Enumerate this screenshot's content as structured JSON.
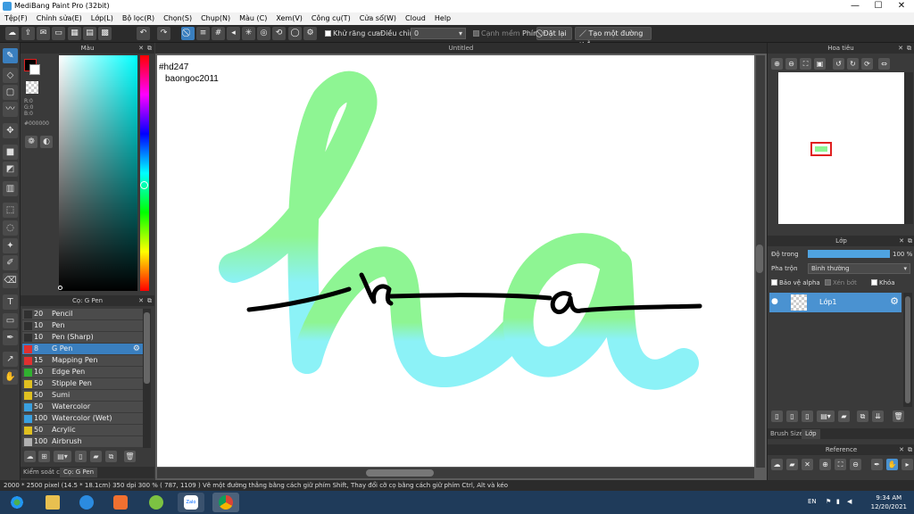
{
  "window": {
    "title": "MediBang Paint Pro (32bit)",
    "minimize": "—",
    "maximize": "☐",
    "close": "✕"
  },
  "menu": [
    "Tệp(F)",
    "Chỉnh sửa(E)",
    "Lớp(L)",
    "Bộ lọc(R)",
    "Chọn(S)",
    "Chụp(N)",
    "Màu (C)",
    "Xem(V)",
    "Công cụ(T)",
    "Cửa sổ(W)",
    "Cloud",
    "Help"
  ],
  "toolbar": {
    "antialias_label": "Khử răng cưa",
    "adjust_label": "Điều chỉnh",
    "adjust_value": "0",
    "smooth_edge_label": "Cạnh mềm",
    "key_label": "Phím",
    "reset_label": "Đặt lại",
    "create_line_label": "Tạo một đường thẳng"
  },
  "color_panel": {
    "title": "Màu",
    "r": "R:0",
    "g": "G:0",
    "b": "B:0",
    "hex": "#000000",
    "fg_color": "#000000",
    "hue_marker_fraction": 0.55
  },
  "brush_panel": {
    "title": "Cọ: G Pen",
    "brushes": [
      {
        "size": "20",
        "name": "Pencil",
        "color": "#303030",
        "selected": false
      },
      {
        "size": "10",
        "name": "Pen",
        "color": "#303030",
        "selected": false
      },
      {
        "size": "10",
        "name": "Pen (Sharp)",
        "color": "#303030",
        "selected": false
      },
      {
        "size": "8",
        "name": "G Pen",
        "color": "#e03030",
        "selected": true
      },
      {
        "size": "15",
        "name": "Mapping Pen",
        "color": "#e03030",
        "selected": false
      },
      {
        "size": "10",
        "name": "Edge Pen",
        "color": "#30b030",
        "selected": false
      },
      {
        "size": "50",
        "name": "Stipple Pen",
        "color": "#e0c020",
        "selected": false
      },
      {
        "size": "50",
        "name": "Sumi",
        "color": "#e0c020",
        "selected": false
      },
      {
        "size": "50",
        "name": "Watercolor",
        "color": "#3aa0e0",
        "selected": false
      },
      {
        "size": "100",
        "name": "Watercolor (Wet)",
        "color": "#3aa0e0",
        "selected": false
      },
      {
        "size": "50",
        "name": "Acrylic",
        "color": "#e0c020",
        "selected": false
      },
      {
        "size": "100",
        "name": "Airbrush",
        "color": "#b0b0b0",
        "selected": false
      }
    ],
    "tab_control": "Kiểm soát cọ",
    "tab_brush": "Cọ: G Pen"
  },
  "canvas": {
    "doc_title": "Untitled",
    "text_line1": "#hd247",
    "text_line2": "baongoc2011",
    "green": "#8ef593",
    "cyan": "#8cf2f7"
  },
  "navigator": {
    "title": "Hoa tiêu"
  },
  "layers": {
    "title": "Lớp",
    "opacity_label": "Độ trong",
    "opacity_value": "100 %",
    "opacity_fraction": 1.0,
    "blend_label": "Pha trộn",
    "blend_value": "Bình thường",
    "protect_alpha": "Bảo vệ alpha",
    "clipping": "Xén bớt",
    "lock": "Khóa",
    "layer_name": "Lớp1",
    "tab_brush_size": "Brush Size",
    "tab_layer": "Lớp"
  },
  "reference": {
    "title": "Reference"
  },
  "status": "2000 * 2500 pixel   (14.5 * 18.1cm)   350 dpi   300 %   ( 787, 1109 )   Vẽ một đường thẳng bằng cách giữ phím Shift, Thay đổi cỡ cọ bằng cách giữ phím Ctrl, Alt và kéo",
  "taskbar": {
    "lang": "EN",
    "time": "9:34 AM",
    "date": "12/20/2021",
    "zalo": "Zalo"
  }
}
